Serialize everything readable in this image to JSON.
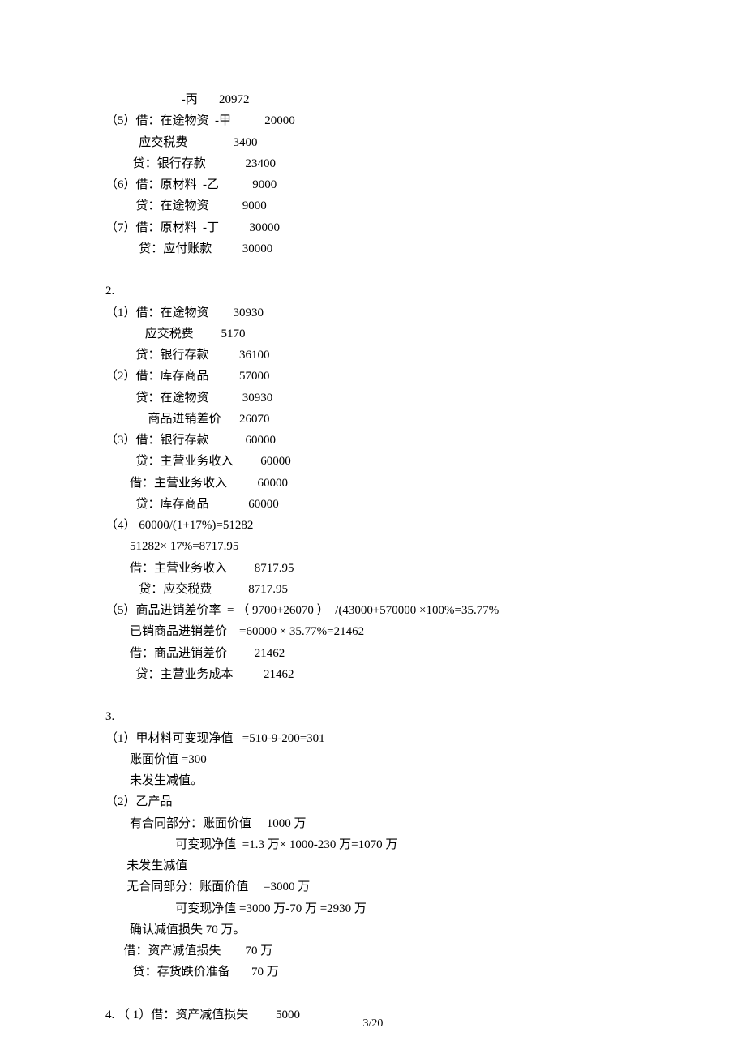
{
  "lines": [
    "                         -丙       20972",
    "（5）借：在途物资  -甲           20000",
    "           应交税费               3400",
    "         贷：银行存款             23400",
    "（6）借：原材料  -乙           9000",
    "          贷：在途物资           9000",
    "（7）借：原材料  -丁          30000",
    "           贷：应付账款          30000",
    "",
    "2.",
    "（1）借：在途物资        30930",
    "             应交税费         5170",
    "          贷：银行存款          36100",
    "（2）借：库存商品          57000",
    "          贷：在途物资           30930",
    "              商品进销差价      26070",
    "（3）借：银行存款            60000",
    "          贷：主营业务收入         60000",
    "        借：主营业务收入          60000",
    "          贷：库存商品             60000",
    "（4） 60000/(1+17%)=51282",
    "        51282× 17%=8717.95",
    "        借：主营业务收入         8717.95",
    "           贷：应交税费            8717.95",
    "（5）商品进销差价率  = （ 9700+26070 ）  /(43000+570000 ×100%=35.77%",
    "        已销商品进销差价    =60000 × 35.77%=21462",
    "        借：商品进销差价         21462",
    "          贷：主营业务成本          21462",
    "",
    "3.",
    "（1）甲材料可变现净值   =510-9-200=301",
    "        账面价值 =300",
    "        未发生减值。",
    "（2）乙产品",
    "        有合同部分：账面价值     1000 万",
    "                       可变现净值  =1.3 万× 1000-230 万=1070 万",
    "       未发生减值",
    "       无合同部分：账面价值     =3000 万",
    "                       可变现净值 =3000 万-70 万 =2930 万",
    "        确认减值损失 70 万。",
    "      借：资产减值损失        70 万",
    "         贷：存货跌价准备       70 万",
    "",
    "4. （ 1）借：资产减值损失         5000"
  ],
  "footer": "3/20"
}
